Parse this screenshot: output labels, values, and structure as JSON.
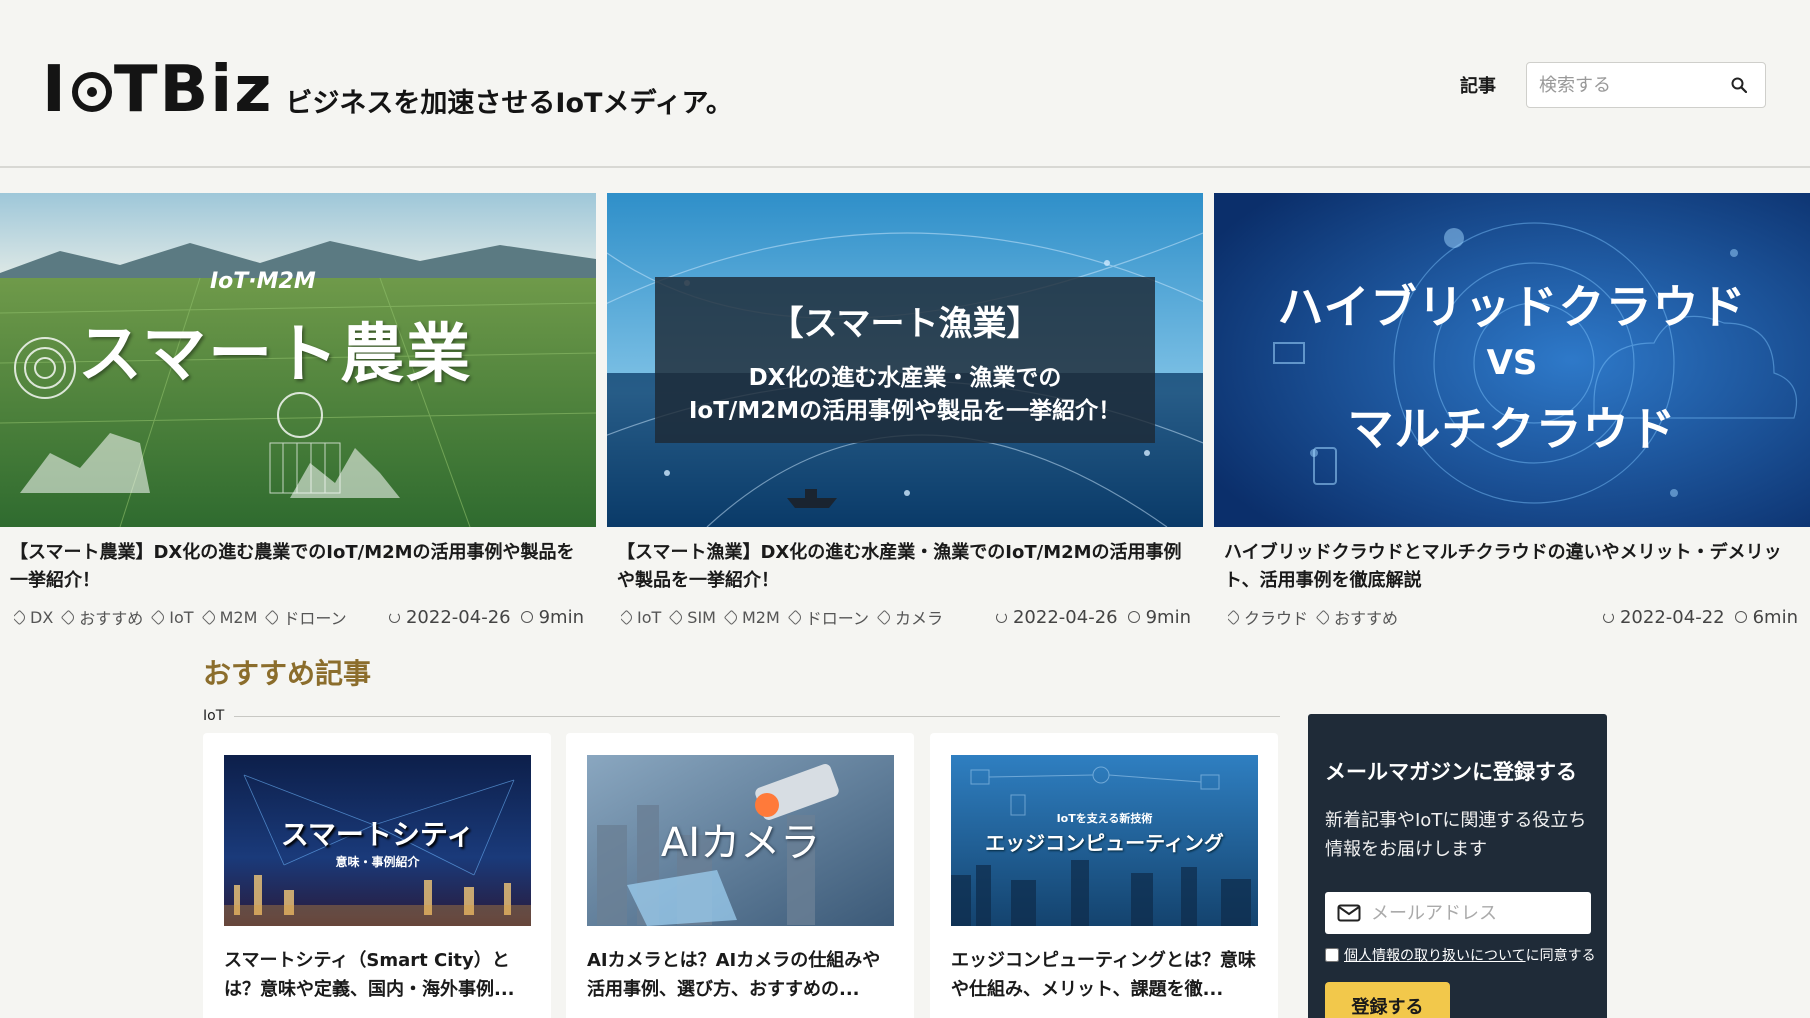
{
  "header": {
    "logo_text_left": "I",
    "logo_text_right": "TBiz",
    "tagline": "ビジネスを加速させるIoTメディア。",
    "nav_articles": "記事",
    "search_placeholder": "検索する"
  },
  "hero": [
    {
      "image_caption_top": "IoT·M2M",
      "image_caption_main": "スマート農業",
      "title": "【スマート農業】DX化の進む農業でのIoT/M2Mの活用事例や製品を一挙紹介！",
      "tags": [
        "DX",
        "おすすめ",
        "IoT",
        "M2M",
        "ドローン"
      ],
      "date": "2022-04-26",
      "read_time": "9min"
    },
    {
      "image_caption_top": "【スマート漁業】",
      "image_caption_main": "DX化の進む水産業・漁業での",
      "image_caption_sub": "IoT/M2Mの活用事例や製品を一挙紹介！",
      "title": "【スマート漁業】DX化の進む水産業・漁業でのIoT/M2Mの活用事例や製品を一挙紹介！",
      "tags": [
        "IoT",
        "SIM",
        "M2M",
        "ドローン",
        "カメラ"
      ],
      "date": "2022-04-26",
      "read_time": "9min"
    },
    {
      "image_caption_top": "ハイブリッドクラウド",
      "image_caption_main": "VS",
      "image_caption_sub": "マルチクラウド",
      "title": "ハイブリッドクラウドとマルチクラウドの違いやメリット・デメリット、活用事例を徹底解説",
      "tags": [
        "クラウド",
        "おすすめ"
      ],
      "date": "2022-04-22",
      "read_time": "6min"
    }
  ],
  "recommended": {
    "title": "おすすめ記事",
    "category": "IoT",
    "cards": [
      {
        "image_caption": "スマートシティ",
        "image_sub": "意味・事例紹介",
        "title": "スマートシティ（Smart City）とは？意味や定義、国内・海外事例..."
      },
      {
        "image_caption": "AIカメラ",
        "title": "AIカメラとは？AIカメラの仕組みや活用事例、選び方、おすすめの..."
      },
      {
        "image_sub": "IoTを支える新技術",
        "image_caption": "エッジコンピューティング",
        "title": "エッジコンピューティングとは？意味や仕組み、メリット、課題を徹..."
      }
    ]
  },
  "newsletter": {
    "title": "メールマガジンに登録する",
    "description": "新着記事やIoTに関連する役立ち情報をお届けします",
    "email_placeholder": "メールアドレス",
    "consent_link": "個人情報の取り扱いについて",
    "consent_suffix": "に同意する",
    "submit_label": "登録する"
  },
  "colors": {
    "accent_gold": "#8b6d2c",
    "newsletter_bg": "#1f2b38",
    "button_yellow": "#f2c84b"
  }
}
